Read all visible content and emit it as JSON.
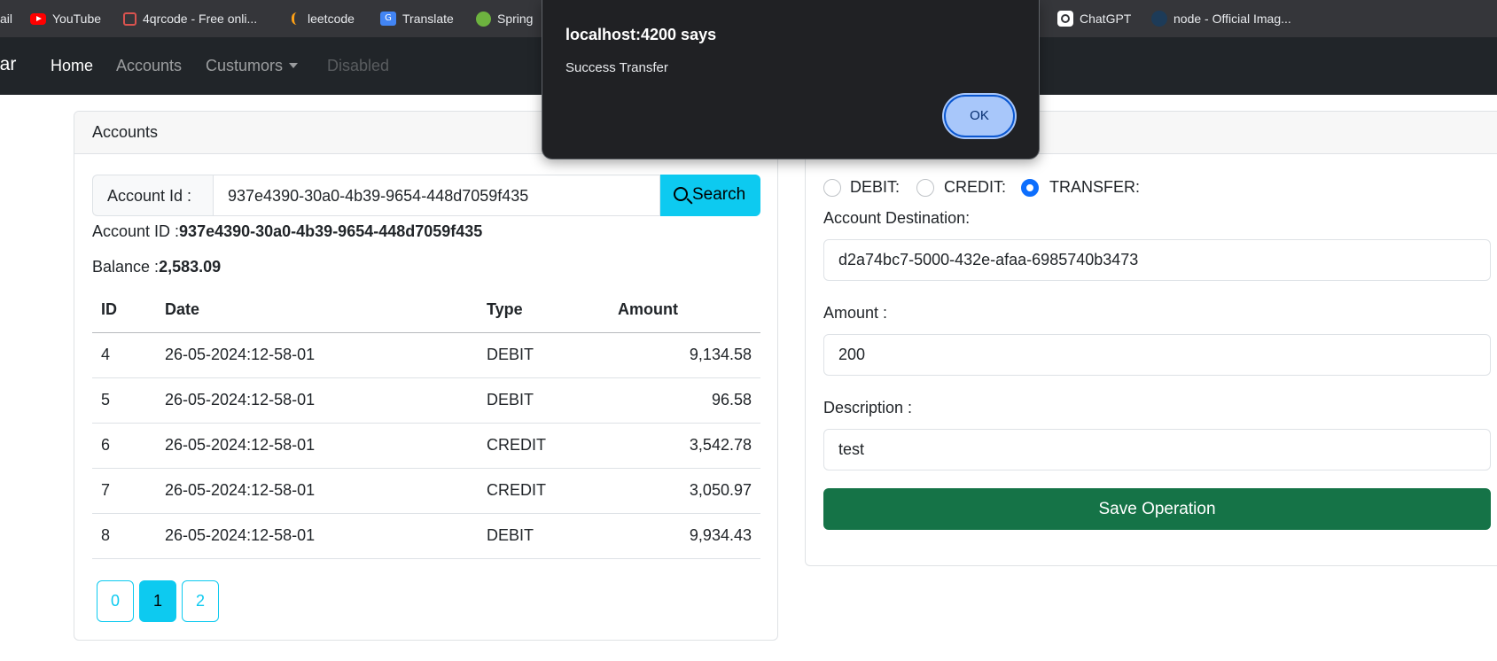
{
  "bookmarks": [
    {
      "label": "ail",
      "icon": "mail-icon"
    },
    {
      "label": "YouTube",
      "icon": "youtube-icon",
      "color": "#ff0000"
    },
    {
      "label": "4qrcode - Free onli...",
      "icon": "qrcode-icon"
    },
    {
      "label": "leetcode",
      "icon": "leetcode-icon",
      "color": "#ffa116"
    },
    {
      "label": "Translate",
      "icon": "translate-icon",
      "color": "#4285f4"
    },
    {
      "label": "Spring",
      "icon": "spring-icon",
      "color": "#6db33f"
    },
    {
      "label": "ChatGPT",
      "icon": "chatgpt-icon"
    },
    {
      "label": "node - Official Imag...",
      "icon": "docker-icon"
    }
  ],
  "navbar": {
    "brand": "bar",
    "links": [
      {
        "label": "Home",
        "state": "active"
      },
      {
        "label": "Accounts",
        "state": "normal"
      },
      {
        "label": "Custumors",
        "state": "dropdown"
      },
      {
        "label": "Disabled",
        "state": "disabled"
      }
    ]
  },
  "accounts_card": {
    "header": "Accounts",
    "search": {
      "label": "Account Id :",
      "value": "937e4390-30a0-4b39-9654-448d7059f435",
      "button": "Search"
    },
    "account_id_label": "Account ID :",
    "account_id_value": "937e4390-30a0-4b39-9654-448d7059f435",
    "balance_label": "Balance :",
    "balance_value": "2,583.09",
    "table": {
      "headers": [
        "ID",
        "Date",
        "Type",
        "Amount"
      ],
      "rows": [
        [
          "4",
          "26-05-2024:12-58-01",
          "DEBIT",
          "9,134.58"
        ],
        [
          "5",
          "26-05-2024:12-58-01",
          "DEBIT",
          "96.58"
        ],
        [
          "6",
          "26-05-2024:12-58-01",
          "CREDIT",
          "3,542.78"
        ],
        [
          "7",
          "26-05-2024:12-58-01",
          "CREDIT",
          "3,050.97"
        ],
        [
          "8",
          "26-05-2024:12-58-01",
          "DEBIT",
          "9,934.43"
        ]
      ]
    },
    "pages": [
      "0",
      "1",
      "2"
    ],
    "active_page": "1"
  },
  "operation_form": {
    "types": [
      {
        "label": "DEBIT:",
        "checked": false
      },
      {
        "label": "CREDIT:",
        "checked": false
      },
      {
        "label": "TRANSFER:",
        "checked": true
      }
    ],
    "destination_label": "Account Destination:",
    "destination_value": "d2a74bc7-5000-432e-afaa-6985740b3473",
    "amount_label": "Amount :",
    "amount_value": "200",
    "description_label": "Description :",
    "description_value": "test",
    "save_button": "Save Operation"
  },
  "alert": {
    "title": "localhost:4200 says",
    "message": "Success Transfer",
    "ok_label": "OK"
  },
  "colors": {
    "info": "#0dcaf0",
    "success": "#157347",
    "primary": "#0d6efd",
    "navbar": "#212529",
    "dialog": "#202124"
  }
}
